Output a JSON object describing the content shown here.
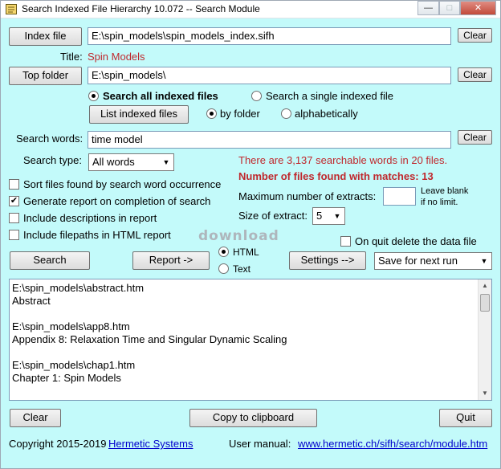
{
  "window": {
    "title": "Search Indexed File Hierarchy 10.072 -- Search Module",
    "minimize_glyph": "—",
    "maximize_glyph": "□",
    "close_glyph": "✕"
  },
  "index": {
    "button": "Index file",
    "value": "E:\\spin_models\\spin_models_index.sifh",
    "clear": "Clear",
    "title_label": "Title:",
    "title_value": "Spin Models"
  },
  "folder": {
    "button": "Top folder",
    "value": "E:\\spin_models\\",
    "clear": "Clear"
  },
  "scope": {
    "all_label": "Search all indexed files",
    "single_label": "Search a single indexed file",
    "list_button": "List indexed files",
    "by_folder": "by folder",
    "alphabetically": "alphabetically"
  },
  "search": {
    "words_label": "Search words:",
    "words_value": "time model",
    "clear": "Clear",
    "type_label": "Search type:",
    "type_value": "All words"
  },
  "info": {
    "searchable": "There are 3,137 searchable words in 20 files.",
    "found": "Number of files found with matches: 13",
    "max_extracts_label": "Maximum number of extracts:",
    "max_extracts_value": "",
    "leave_blank": "Leave blank",
    "if_no_limit": "if no limit.",
    "size_label": "Size of extract:",
    "size_value": "5",
    "on_quit": "On quit delete the data file"
  },
  "options": {
    "sort": "Sort files found by search word occurrence",
    "generate": "Generate report on completion of search",
    "descriptions": "Include descriptions in report",
    "filepaths": "Include filepaths in HTML report",
    "check_mark": "✔"
  },
  "actions": {
    "search": "Search",
    "report": "Report ->",
    "html": "HTML",
    "text": "Text",
    "settings": "Settings -->",
    "save_option": "Save for next run"
  },
  "results": [
    "E:\\spin_models\\abstract.htm",
    "Abstract",
    "",
    "E:\\spin_models\\app8.htm",
    "Appendix 8: Relaxation Time and Singular Dynamic Scaling",
    "",
    "E:\\spin_models\\chap1.htm",
    "Chapter 1: Spin Models"
  ],
  "bottom": {
    "clear": "Clear",
    "copy": "Copy to clipboard",
    "quit": "Quit"
  },
  "footer": {
    "copyright": "Copyright 2015-2019",
    "company": "Hermetic Systems",
    "manual_label": "User manual:",
    "manual_url": "www.hermetic.ch/sifh/search/module.htm"
  },
  "watermark": "download",
  "colors": {
    "background": "#c3fafa",
    "accent_red": "#c0282d",
    "link": "#0000cc"
  }
}
